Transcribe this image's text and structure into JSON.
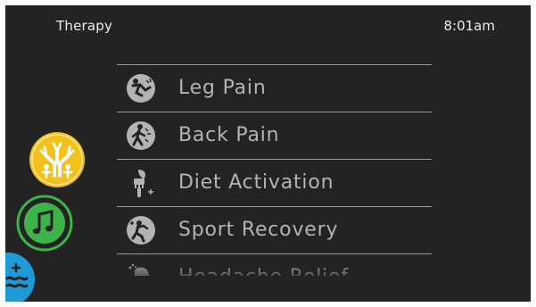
{
  "header": {
    "title": "Therapy",
    "time": "8:01am"
  },
  "menu": {
    "items": [
      {
        "label": "Leg Pain",
        "icon": "leg-pain-icon"
      },
      {
        "label": "Back Pain",
        "icon": "back-pain-icon"
      },
      {
        "label": "Diet Activation",
        "icon": "diet-activation-icon"
      },
      {
        "label": "Sport Recovery",
        "icon": "sport-recovery-icon"
      },
      {
        "label": "Headache Relief",
        "icon": "headache-relief-icon"
      }
    ]
  },
  "side_buttons": [
    {
      "name": "therapy",
      "icon": "tree-people-icon",
      "color": "#f2c21b"
    },
    {
      "name": "music",
      "icon": "music-note-icon",
      "color": "#3db34a"
    },
    {
      "name": "water",
      "icon": "water-waves-icon",
      "color": "#1e9ad6"
    }
  ],
  "colors": {
    "background": "#232323",
    "text": "#ececec",
    "menu_text": "#b3b3b3",
    "divider": "#9a9a9a",
    "therapy_accent": "#f2c21b",
    "music_accent": "#3db34a",
    "water_accent": "#1e9ad6"
  }
}
